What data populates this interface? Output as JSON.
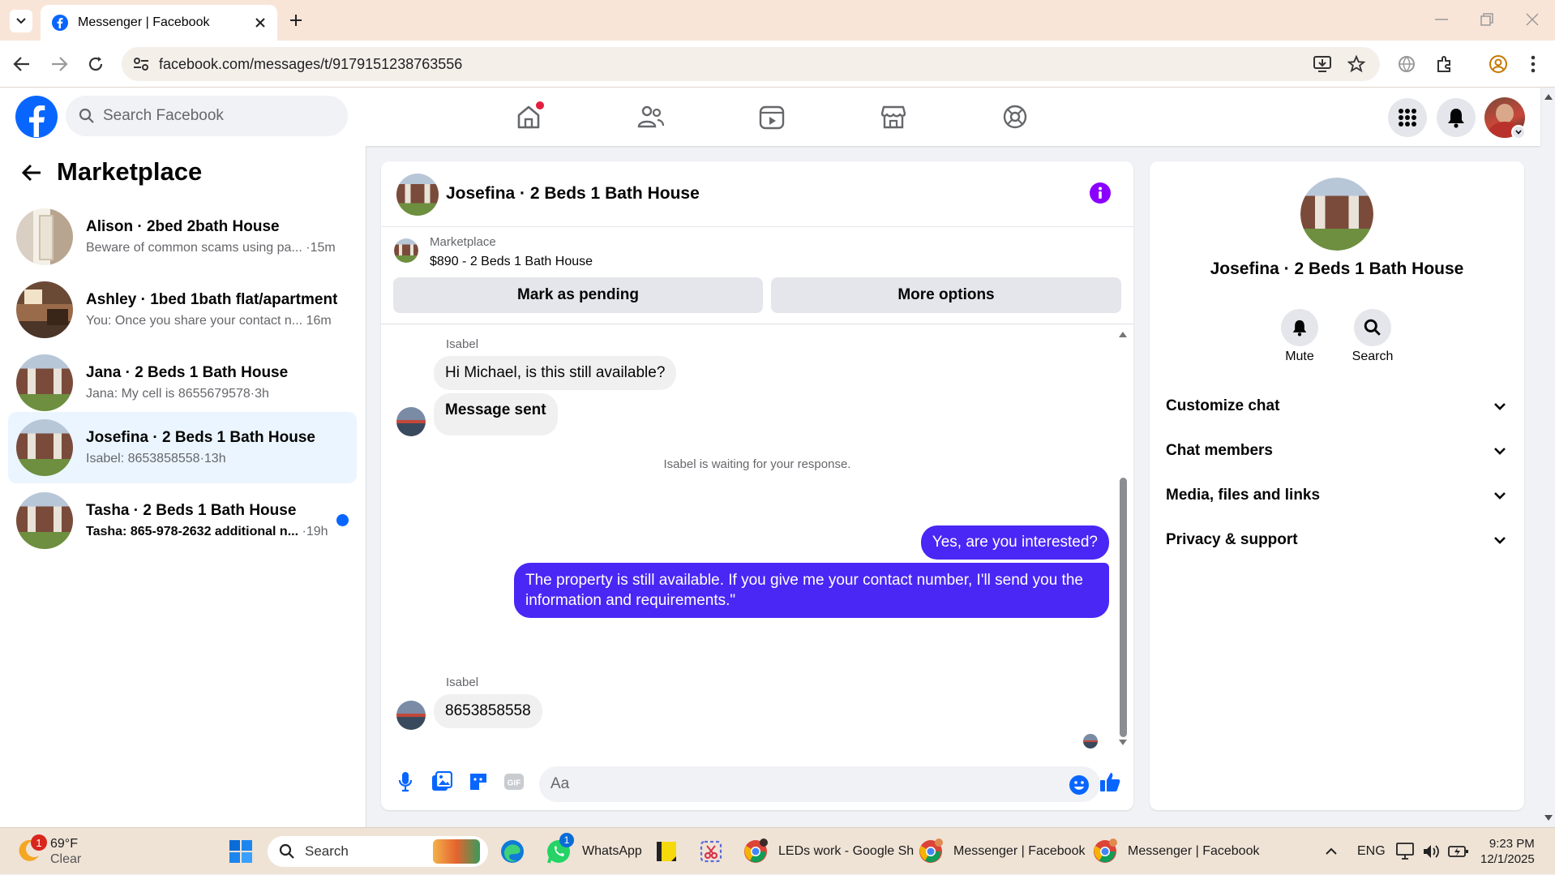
{
  "browser": {
    "tab_title": "Messenger | Facebook",
    "url": "facebook.com/messages/t/9179151238763556"
  },
  "fb": {
    "search_placeholder": "Search Facebook"
  },
  "sidebar": {
    "title": "Marketplace",
    "conversations": [
      {
        "title": "Alison · 2bed 2bath House",
        "preview": "Beware of common scams using pa...",
        "time": "·15m"
      },
      {
        "title": "Ashley · 1bed 1bath flat/apartment",
        "preview": "You: Once you share your contact n...",
        "time": "16m"
      },
      {
        "title": "Jana · 2 Beds 1 Bath House",
        "preview": "Jana: My cell is 8655679578",
        "time": "·3h"
      },
      {
        "title": "Josefina · 2 Beds 1 Bath House",
        "preview": "Isabel: 8653858558",
        "time": "·13h"
      },
      {
        "title": "Tasha · 2 Beds 1 Bath House",
        "preview": "Tasha: 865-978-2632 additional n...",
        "time": "·19h"
      }
    ]
  },
  "chat": {
    "header_title": "Josefina · 2 Beds 1 Bath House",
    "listing_label": "Marketplace",
    "listing_detail": "$890 - 2 Beds 1 Bath House",
    "mark_pending": "Mark as pending",
    "more_options": "More options",
    "sender1": "Isabel",
    "msg1": "Hi Michael, is this still available?",
    "msg2": "Message sent",
    "waiting": "Isabel is waiting for your response.",
    "out1": "Yes, are you interested?",
    "out2_line1": "The property is still available. If you give me your contact number, I'll send you the",
    "out2_line2": "information and requirements.\"",
    "sender2": "Isabel",
    "msg3": "8653858558",
    "composer_placeholder": "Aa"
  },
  "info": {
    "title": "Josefina · 2 Beds 1 Bath House",
    "mute": "Mute",
    "search": "Search",
    "sections": [
      "Customize chat",
      "Chat members",
      "Media, files and links",
      "Privacy & support"
    ]
  },
  "taskbar": {
    "weather_temp": "69°F",
    "weather_desc": "Clear",
    "weather_badge": "1",
    "search": "Search",
    "whatsapp": "WhatsApp",
    "whatsapp_badge": "1",
    "chrome1": "LEDs work - Google Sh",
    "chrome2": "Messenger | Facebook",
    "chrome3": "Messenger | Facebook",
    "lang": "ENG",
    "time": "9:23 PM",
    "date": "12/1/2025"
  },
  "colors": {
    "fb_blue": "#0866ff",
    "out_bubble": "#4a27f5",
    "info_purple": "#8a00ff",
    "unread_dot": "#0866ff"
  }
}
